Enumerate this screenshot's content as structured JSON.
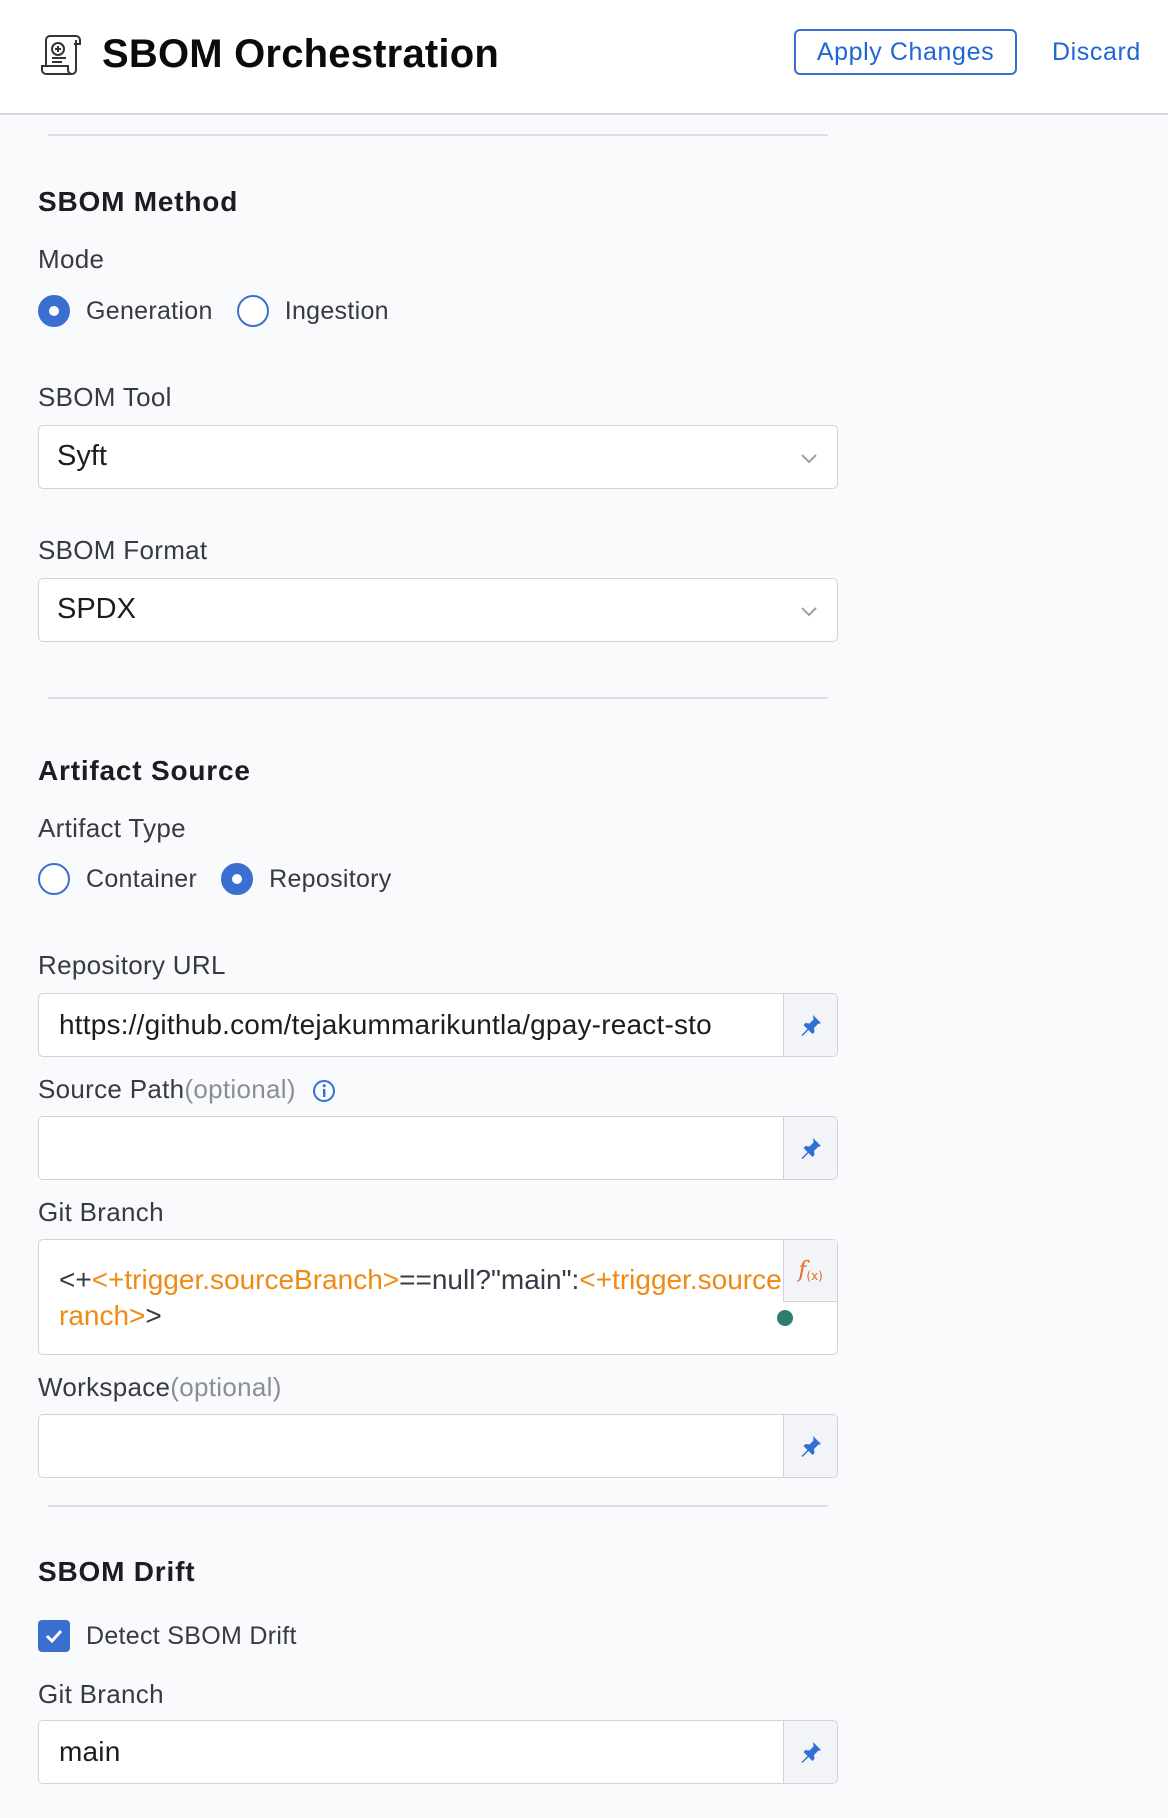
{
  "header": {
    "title": "SBOM Orchestration",
    "icon": "scroll-document-icon",
    "apply_label": "Apply Changes",
    "discard_label": "Discard"
  },
  "sbom_method": {
    "title": "SBOM Method",
    "mode_label": "Mode",
    "mode_options": [
      {
        "label": "Generation",
        "checked": true
      },
      {
        "label": "Ingestion",
        "checked": false
      }
    ],
    "tool_label": "SBOM Tool",
    "tool_value": "Syft",
    "format_label": "SBOM Format",
    "format_value": "SPDX"
  },
  "artifact_source": {
    "title": "Artifact Source",
    "type_label": "Artifact Type",
    "type_options": [
      {
        "label": "Container",
        "checked": false
      },
      {
        "label": "Repository",
        "checked": true
      }
    ],
    "repo_url_label": "Repository URL",
    "repo_url_value": "https://github.com/tejakummarikuntla/gpay-react-sto",
    "source_path_label": "Source Path",
    "source_path_optional": "(optional)",
    "source_path_value": "",
    "git_branch_label": "Git Branch",
    "git_branch_expr": {
      "p1": "<+",
      "t1": "<+trigger.sourceBranch>",
      "p2": "==null?\"main\":",
      "t2": "<+trigger.sourceBranch>",
      "p3": ">"
    },
    "workspace_label": "Workspace",
    "workspace_optional": "(optional)",
    "workspace_value": ""
  },
  "sbom_drift": {
    "title": "SBOM Drift",
    "detect_label": "Detect SBOM Drift",
    "detect_checked": true,
    "git_branch_label": "Git Branch",
    "git_branch_value": "main"
  },
  "colors": {
    "accent": "#3b6fcf",
    "link": "#1f66d4",
    "expression": "#f08a12",
    "status_ok": "#2f7d6c"
  }
}
